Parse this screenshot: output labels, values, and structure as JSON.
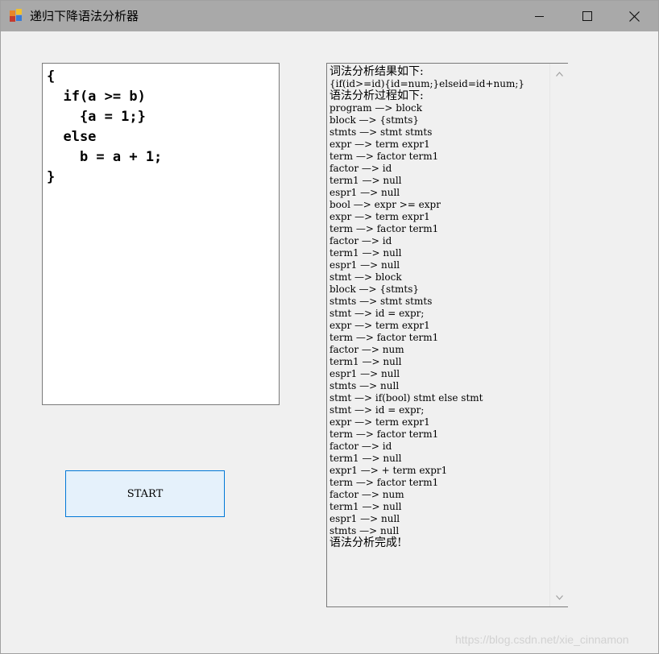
{
  "window": {
    "title": "递归下降语法分析器"
  },
  "code_lines": [
    "{",
    "  if(a >= b)",
    "    {a = 1;}",
    "  else",
    "    b = a + 1;",
    "}"
  ],
  "start_button": {
    "label": "START"
  },
  "output_lines": [
    "词法分析结果如下:",
    "{if(id>=id){id=num;}elseid=id+num;}",
    "语法分析过程如下:",
    "program —> block",
    "block —> {stmts}",
    "stmts —> stmt stmts",
    "expr —> term expr1",
    "term —> factor term1",
    "factor —> id",
    "term1 —> null",
    "espr1 —> null",
    "bool —> expr >= expr",
    "expr —> term expr1",
    "term —> factor term1",
    "factor —> id",
    "term1 —> null",
    "espr1 —> null",
    "stmt —> block",
    "block —> {stmts}",
    "stmts —> stmt stmts",
    "stmt —> id = expr;",
    "expr —> term expr1",
    "term —> factor term1",
    "factor —> num",
    "term1 —> null",
    "espr1 —> null",
    "stmts —> null",
    "stmt —> if(bool) stmt else stmt",
    "stmt —> id = expr;",
    "expr —> term expr1",
    "term —> factor term1",
    "factor —> id",
    "term1 —> null",
    "expr1 —> + term expr1",
    "term —> factor term1",
    "factor —> num",
    "term1 —> null",
    "espr1 —> null",
    "stmts —> null",
    "语法分析完成!"
  ],
  "watermark": "https://blog.csdn.net/xie_cinnamon"
}
